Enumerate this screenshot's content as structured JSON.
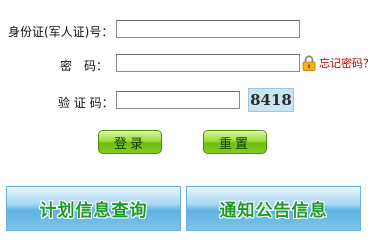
{
  "form": {
    "id_label": "身份证(军人证)号：",
    "id_value": "",
    "password_label": "密　码：",
    "password_value": "",
    "forgot_link": "忘记密码？",
    "captcha_label": "验 证 码：",
    "captcha_value": "",
    "captcha_image_text": "8418"
  },
  "buttons": {
    "login": "登录",
    "reset": "重置"
  },
  "tiles": {
    "plan_query": "计划信息查询",
    "notice": "通知公告信息"
  },
  "colors": {
    "link_red": "#c00000",
    "tile_text_green": "#1b9a2a",
    "button_green": "#84cc22",
    "tile_blue": "#5fb2e2"
  }
}
